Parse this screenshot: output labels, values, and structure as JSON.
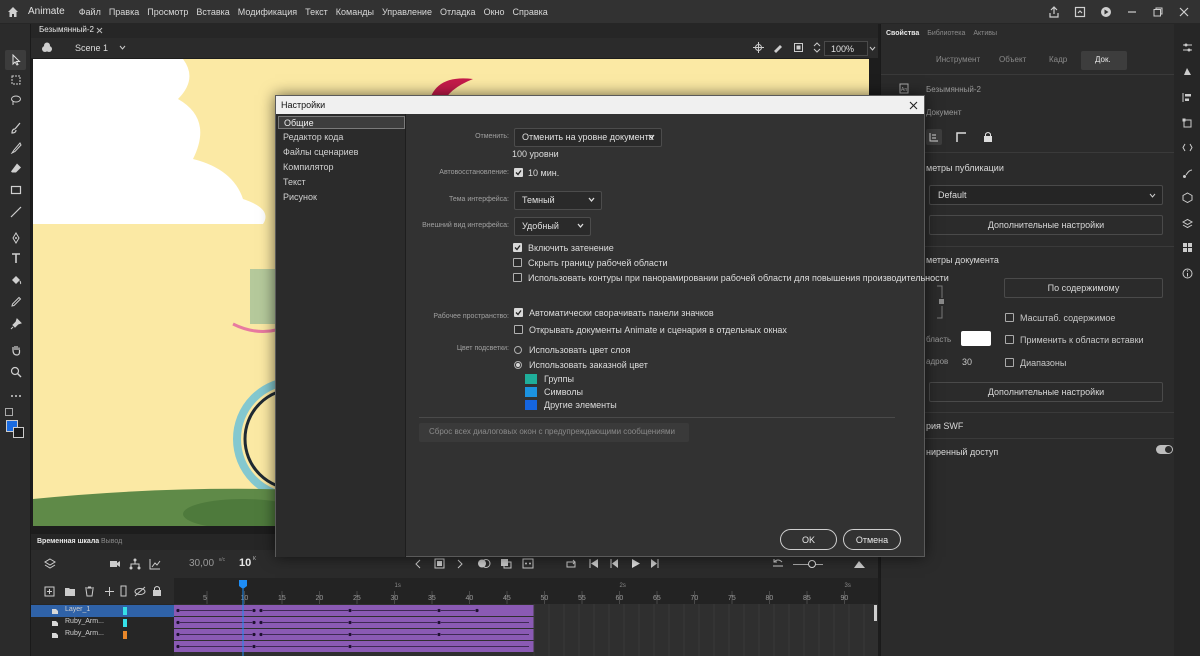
{
  "app": {
    "name": "Animate"
  },
  "menu": [
    "Файл",
    "Правка",
    "Просмотр",
    "Вставка",
    "Модификация",
    "Текст",
    "Команды",
    "Управление",
    "Отладка",
    "Окно",
    "Справка"
  ],
  "document": {
    "tab": "Безымянный-2",
    "scene": "Scene 1",
    "zoom": "100%"
  },
  "timeline": {
    "tabs": [
      "Временная шкала",
      "Вывод"
    ],
    "fps": "30,00",
    "fps_unit": "к/с",
    "current_frame": "10",
    "frame_suffix": "К",
    "ruler_ticks": [
      "5",
      "10",
      "15",
      "20",
      "25",
      "30",
      "35",
      "40",
      "45",
      "50",
      "55",
      "60",
      "65",
      "70",
      "75",
      "80",
      "85",
      "90"
    ],
    "second_marks": [
      "1s",
      "2s",
      "3s"
    ],
    "layers": [
      {
        "name": "Layer_1",
        "color": "#35e0e8",
        "selected": true
      },
      {
        "name": "Ruby_Arm...",
        "color": "#35e0e8",
        "selected": false
      },
      {
        "name": "Ruby_Arm...",
        "color": "#e8872a",
        "selected": false
      }
    ]
  },
  "properties": {
    "tabs": [
      "Свойства",
      "Библиотека",
      "Активы"
    ],
    "subtabs": [
      "Инструмент",
      "Объект",
      "Кадр",
      "Док."
    ],
    "doc_name": "Безымянный-2",
    "doc_label": "Документ",
    "publish_header": "метры публикации",
    "profile": "Default",
    "advanced_btn": "Дополнительные настройки",
    "doc_header": "метры документа",
    "fit_btn": "По содержимому",
    "scale_content": "Масштаб. содержимое",
    "apply_paste": "Применить к области вставки",
    "spans": "Диапазоны",
    "area_label": "бласть",
    "frames_label": "адров",
    "fps_value": "30",
    "advanced_btn2": "Дополнительные настройки",
    "swf_header": "рия SWF",
    "access_label": "ниренный доступ"
  },
  "dialog": {
    "title": "Настройки",
    "categories": [
      "Общие",
      "Редактор кода",
      "Файлы сценариев",
      "Компилятор",
      "Текст",
      "Рисунок"
    ],
    "undo_label": "Отменить:",
    "undo_value": "Отменить на уровне документа",
    "undo_levels": "100 уровни",
    "autorecovery_label": "Автовосстановление:",
    "autorecovery_value": "10 мин.",
    "theme_label": "Тема интерфейса:",
    "theme_value": "Темный",
    "appearance_label": "Внешний вид интерфейса:",
    "appearance_value": "Удобный",
    "enable_shading": "Включить затенение",
    "hide_stage_border": "Скрыть границу рабочей области",
    "use_outlines": "Использовать контуры при панорамировании рабочей области для повышения производительности",
    "workspace_label": "Рабочее пространство:",
    "auto_collapse": "Автоматически сворачивать панели значков",
    "open_separate": "Открывать документы Animate и сценария в отдельных окнах",
    "highlight_label": "Цвет подсветки:",
    "use_layer_color": "Использовать цвет слоя",
    "use_custom_color": "Использовать заказной цвет",
    "groups": "Группы",
    "symbols": "Символы",
    "other_elements": "Другие элементы",
    "reset_warnings": "Сброс всех диалоговых окон с предупреждающими сообщениями",
    "ok": "OK",
    "cancel": "Отмена",
    "colors": {
      "groups": "#1fae9a",
      "symbols": "#1c93e0",
      "other": "#1565e0"
    }
  }
}
